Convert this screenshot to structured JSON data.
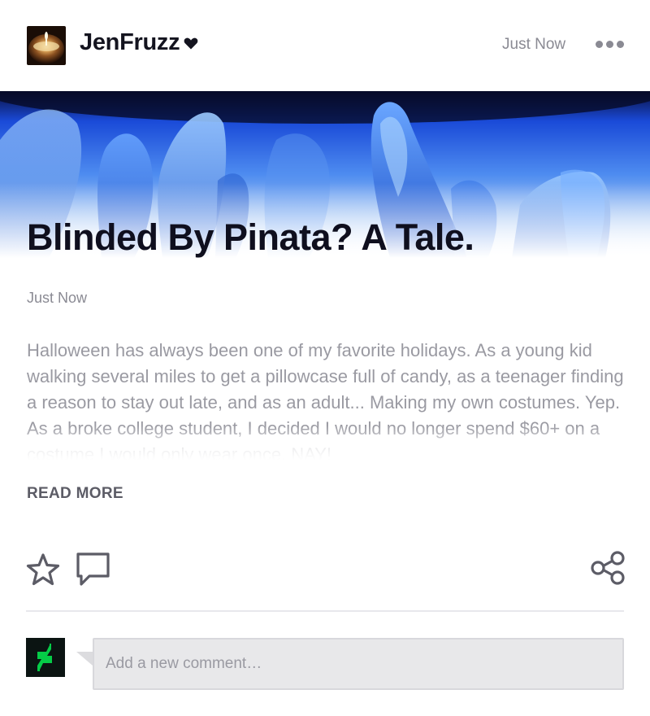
{
  "header": {
    "username": "JenFruzz",
    "timestamp": "Just Now",
    "avatar_icon": "candle-avatar",
    "heart_icon": "heart-icon",
    "more_icon": "more-options-icon"
  },
  "post": {
    "title": "Blinded By Pinata? A Tale.",
    "date": "Just Now",
    "excerpt": "Halloween has always been one of my favorite holidays. As a young kid walking several miles to get a pillowcase full of candy, as a teenager finding a reason to stay out late, and as an adult... Making my own costumes. Yep. As a broke college student, I decided I would no longer spend $60+ on a costume I would only wear once. NAY!",
    "read_more_label": "READ MORE"
  },
  "actions": {
    "favorite_icon": "star-icon",
    "comment_icon": "comment-icon",
    "share_icon": "share-icon"
  },
  "comment_box": {
    "placeholder": "Add a new comment…",
    "avatar_icon": "deviantart-logo"
  },
  "colors": {
    "accent_green": "#05cc47",
    "title_text": "#0f0f1e",
    "muted_text": "#8a8a93",
    "icon_gray": "#5c5c66"
  }
}
